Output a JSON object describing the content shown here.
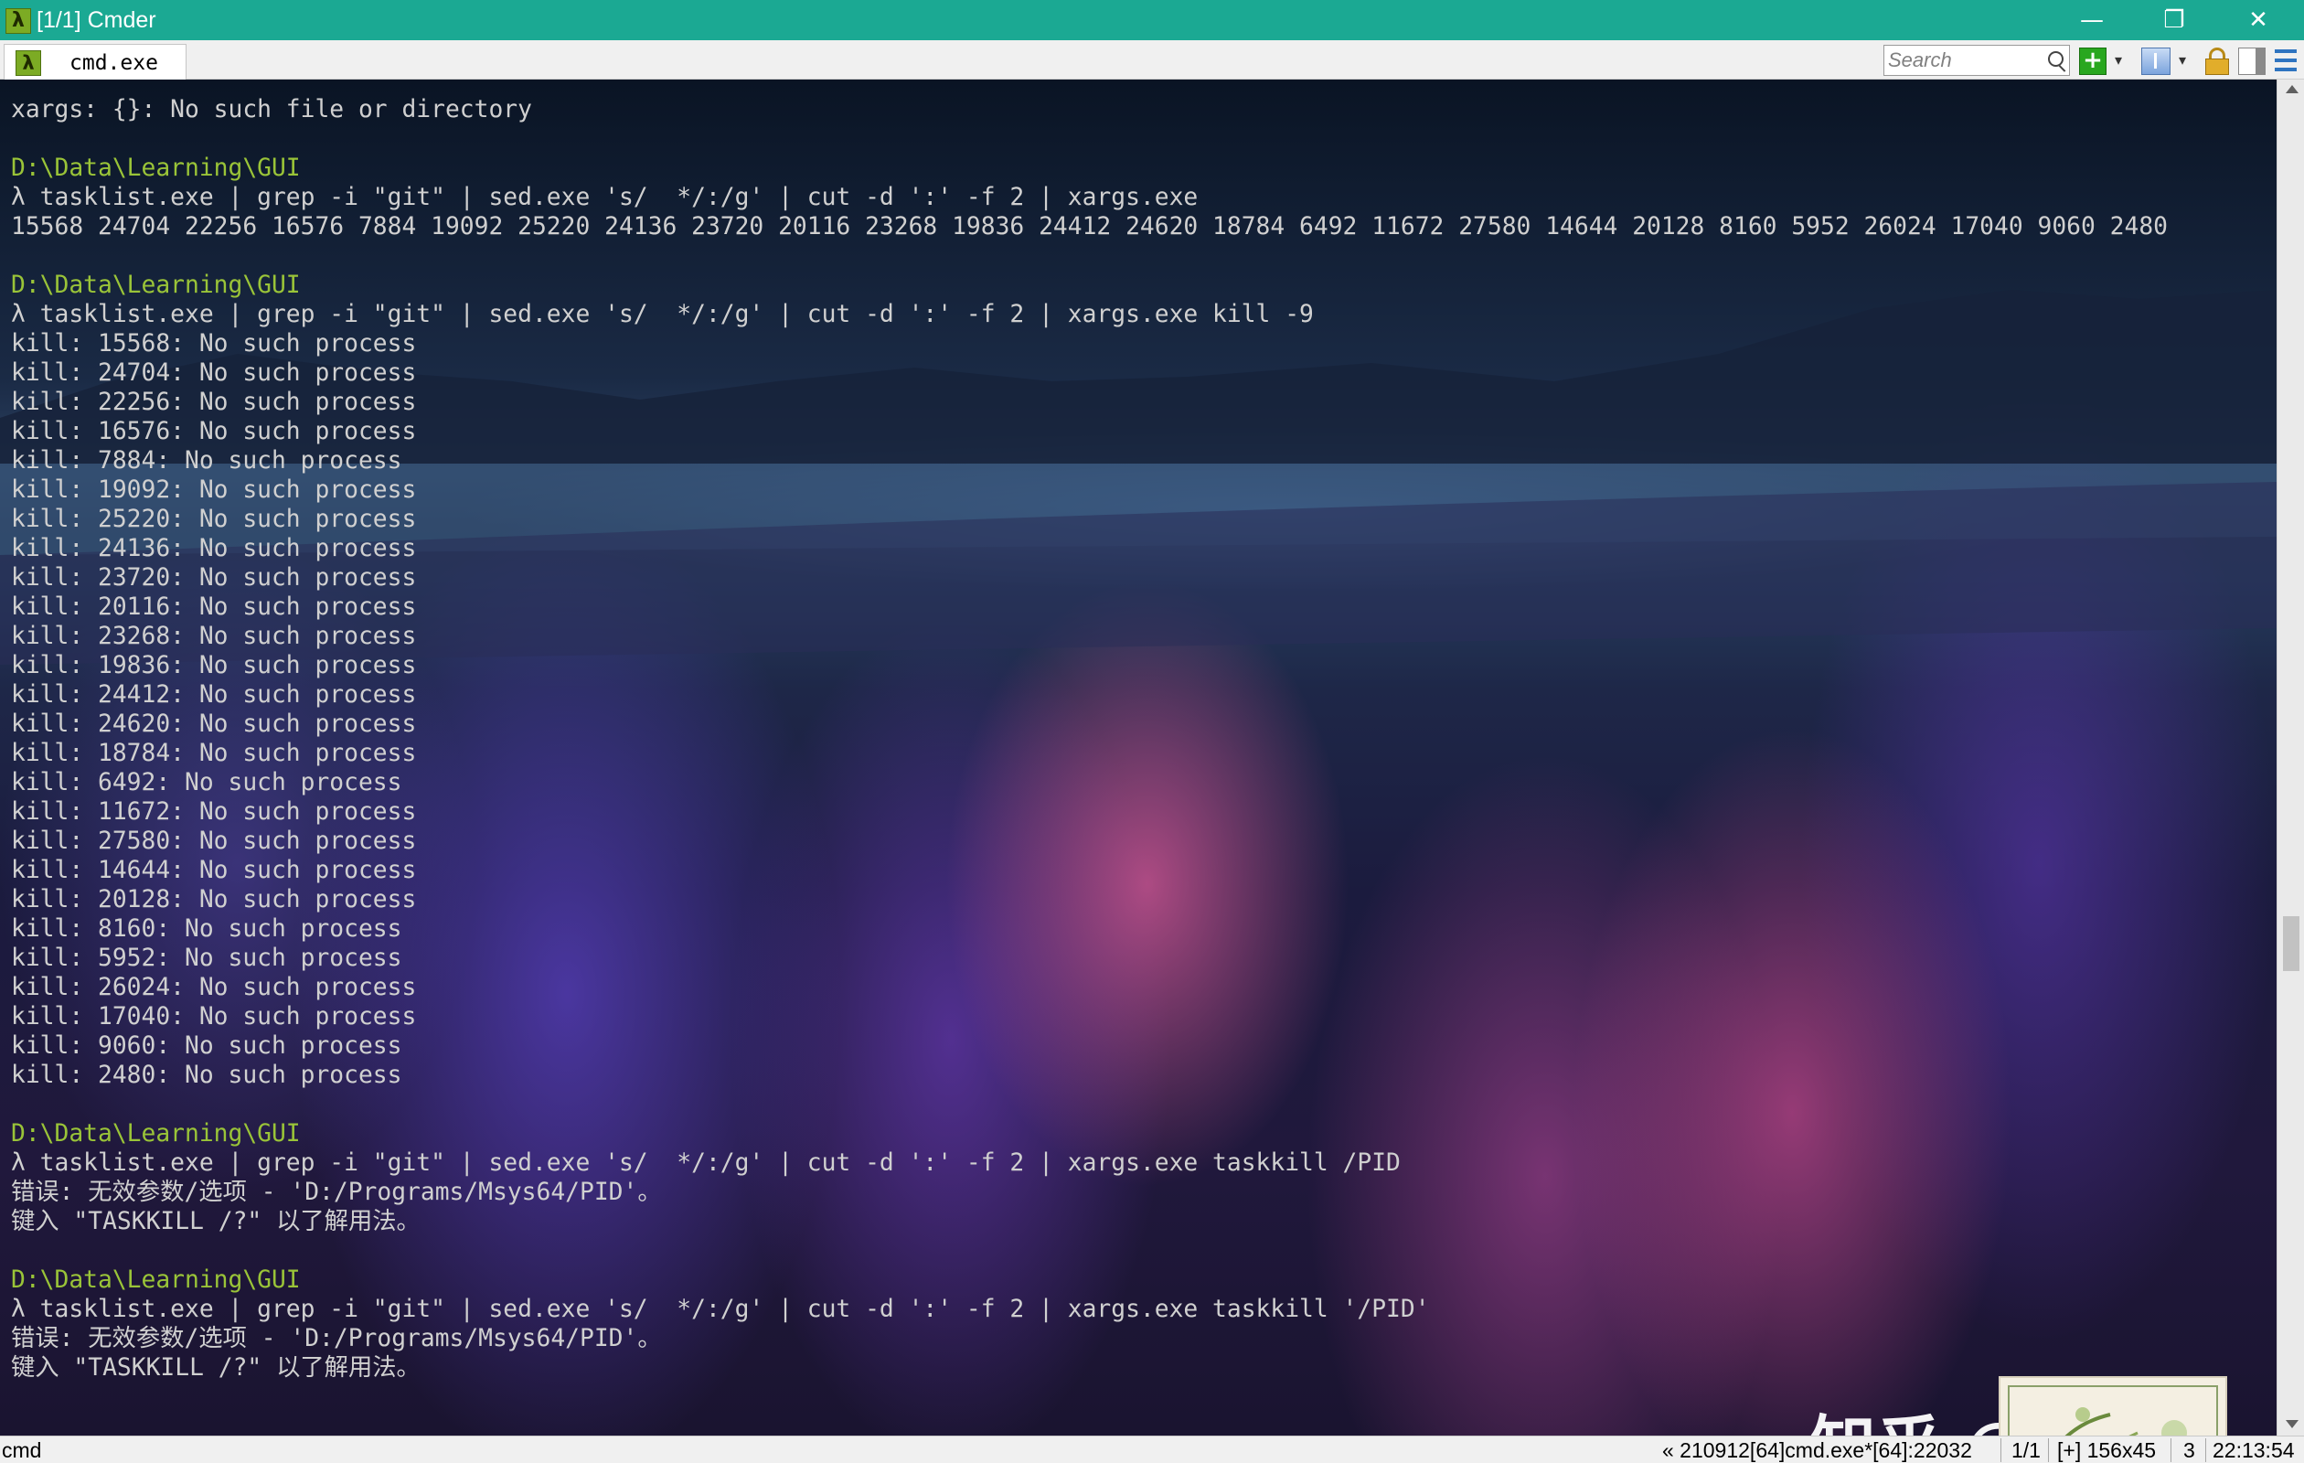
{
  "window": {
    "title": "[1/1] Cmder",
    "app_icon": "λ",
    "minimize": "—",
    "maximize": "❐",
    "close": "✕"
  },
  "tabbar": {
    "tab_label": "cmd.exe",
    "tab_icon": "λ",
    "search_placeholder": "Search",
    "add_dropdown": "▾",
    "split_dropdown": "▾"
  },
  "console": {
    "lines": [
      "xargs: {}: No such file or directory",
      "",
      "D:\\Data\\Learning\\GUI",
      "λ tasklist.exe | grep -i \"git\" | sed.exe 's/  */:/g' | cut -d ':' -f 2 | xargs.exe",
      "15568 24704 22256 16576 7884 19092 25220 24136 23720 20116 23268 19836 24412 24620 18784 6492 11672 27580 14644 20128 8160 5952 26024 17040 9060 2480",
      "",
      "D:\\Data\\Learning\\GUI",
      "λ tasklist.exe | grep -i \"git\" | sed.exe 's/  */:/g' | cut -d ':' -f 2 | xargs.exe kill -9",
      "kill: 15568: No such process",
      "kill: 24704: No such process",
      "kill: 22256: No such process",
      "kill: 16576: No such process",
      "kill: 7884: No such process",
      "kill: 19092: No such process",
      "kill: 25220: No such process",
      "kill: 24136: No such process",
      "kill: 23720: No such process",
      "kill: 20116: No such process",
      "kill: 23268: No such process",
      "kill: 19836: No such process",
      "kill: 24412: No such process",
      "kill: 24620: No such process",
      "kill: 18784: No such process",
      "kill: 6492: No such process",
      "kill: 11672: No such process",
      "kill: 27580: No such process",
      "kill: 14644: No such process",
      "kill: 20128: No such process",
      "kill: 8160: No such process",
      "kill: 5952: No such process",
      "kill: 26024: No such process",
      "kill: 17040: No such process",
      "kill: 9060: No such process",
      "kill: 2480: No such process",
      "",
      "D:\\Data\\Learning\\GUI",
      "λ tasklist.exe | grep -i \"git\" | sed.exe 's/  */:/g' | cut -d ':' -f 2 | xargs.exe taskkill /PID",
      "错误: 无效参数/选项 - 'D:/Programs/Msys64/PID'。",
      "键入 \"TASKKILL /?\" 以了解用法。",
      "",
      "D:\\Data\\Learning\\GUI",
      "λ tasklist.exe | grep -i \"git\" | sed.exe 's/  */:/g' | cut -d ':' -f 2 | xargs.exe taskkill '/PID'",
      "错误: 无效参数/选项 - 'D:/Programs/Msys64/PID'。",
      "键入 \"TASKKILL /?\" 以了解用法。"
    ],
    "prompt_line_indices": [
      2,
      6,
      35,
      40
    ]
  },
  "watermark": {
    "text": "知乎 @叶芝秋"
  },
  "statusbar": {
    "left": "cmd",
    "process": "« 210912[64]cmd.exe*[64]:22032",
    "console_index": "1/1",
    "size": "[+] 156x45",
    "count": "3",
    "time": "22:13:54"
  },
  "colors": {
    "titlebar": "#1ba993",
    "prompt": "#9ac438",
    "console_text": "#d0d0d0"
  }
}
